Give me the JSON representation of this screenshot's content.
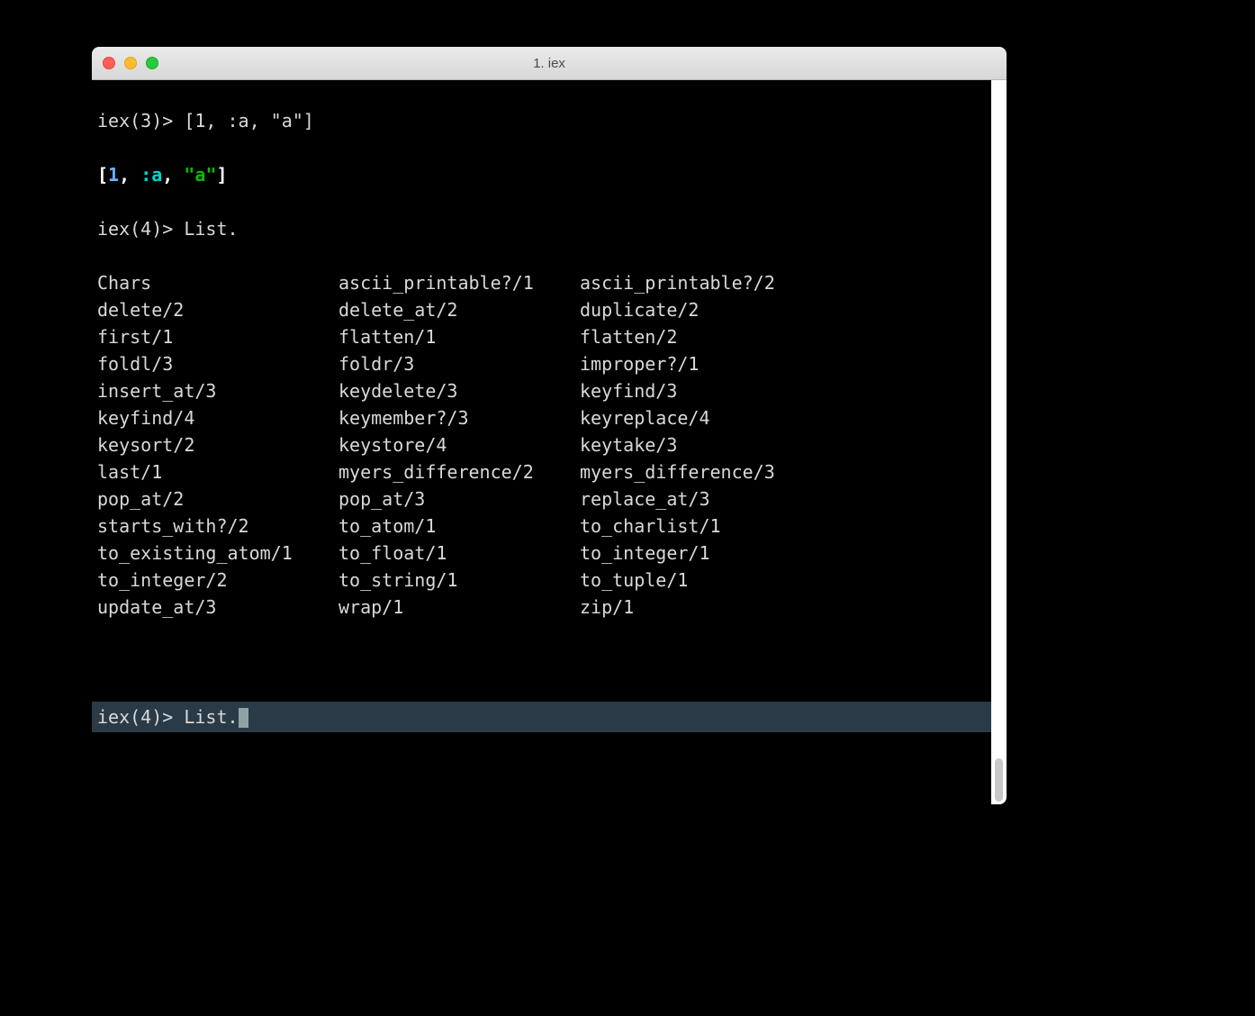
{
  "window": {
    "title": "1. iex"
  },
  "colors": {
    "close": "#ff5f56",
    "minimize": "#ffbd2e",
    "zoom": "#27c93f"
  },
  "session": {
    "prompt3": "iex(3)>",
    "input3": "[1, :a, \"a\"]",
    "result_open": "[",
    "result_num": "1",
    "result_c1": ", ",
    "result_atom": ":a",
    "result_c2": ", ",
    "result_str": "\"a\"",
    "result_close": "]",
    "prompt4": "iex(4)>",
    "input4": "List.",
    "completions": {
      "col1": [
        "Chars",
        "delete/2",
        "first/1",
        "foldl/3",
        "insert_at/3",
        "keyfind/4",
        "keysort/2",
        "last/1",
        "pop_at/2",
        "starts_with?/2",
        "to_existing_atom/1",
        "to_integer/2",
        "update_at/3"
      ],
      "col2": [
        "ascii_printable?/1",
        "delete_at/2",
        "flatten/1",
        "foldr/3",
        "keydelete/3",
        "keymember?/3",
        "keystore/4",
        "myers_difference/2",
        "pop_at/3",
        "to_atom/1",
        "to_float/1",
        "to_string/1",
        "wrap/1"
      ],
      "col3": [
        "ascii_printable?/2",
        "duplicate/2",
        "flatten/2",
        "improper?/1",
        "keyfind/3",
        "keyreplace/4",
        "keytake/3",
        "myers_difference/3",
        "replace_at/3",
        "to_charlist/1",
        "to_integer/1",
        "to_tuple/1",
        "zip/1"
      ]
    },
    "active_prompt": "iex(4)>",
    "active_input": "List."
  }
}
